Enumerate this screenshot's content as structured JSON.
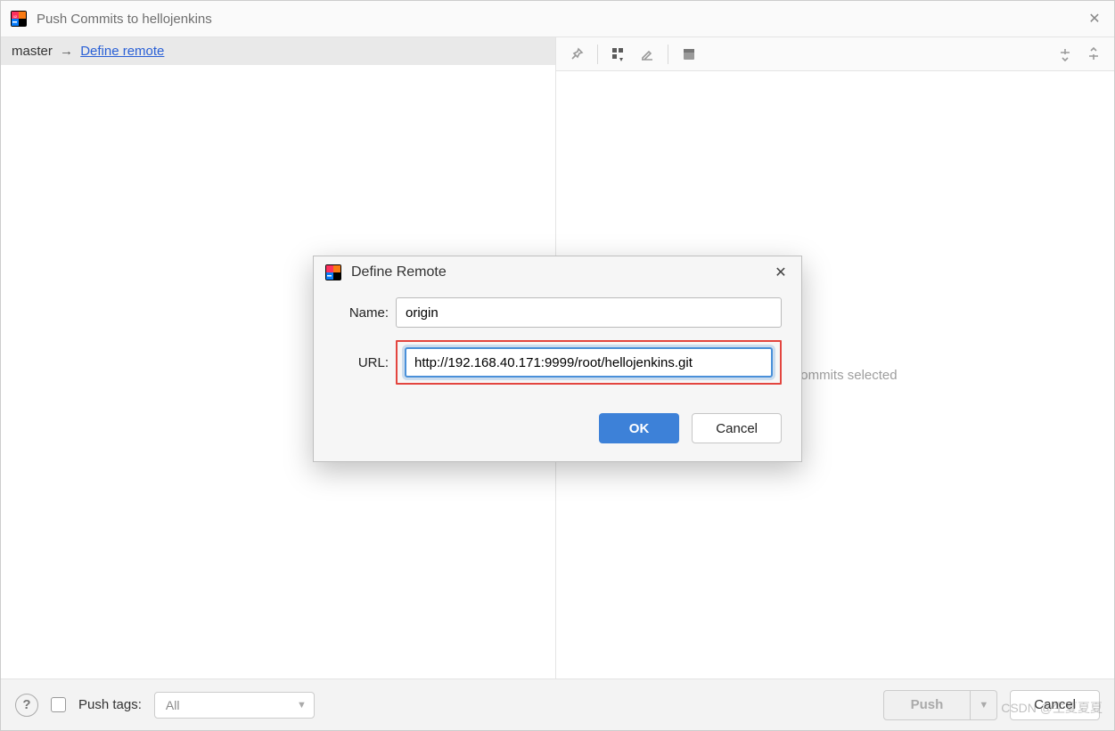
{
  "window": {
    "title": "Push Commits to hellojenkins"
  },
  "branch_bar": {
    "branch": "master",
    "arrow": "→",
    "remote_link": "Define remote"
  },
  "right": {
    "no_commits": "No commits selected"
  },
  "footer": {
    "push_tags_label": "Push tags:",
    "tags_select_value": "All",
    "push_label": "Push",
    "cancel_label": "Cancel"
  },
  "modal": {
    "title": "Define Remote",
    "name_label": "Name:",
    "name_value": "origin",
    "url_label": "URL:",
    "url_value": "http://192.168.40.171:9999/root/hellojenkins.git",
    "ok_label": "OK",
    "cancel_label": "Cancel"
  },
  "watermark": "CSDN @生夏夏夏"
}
